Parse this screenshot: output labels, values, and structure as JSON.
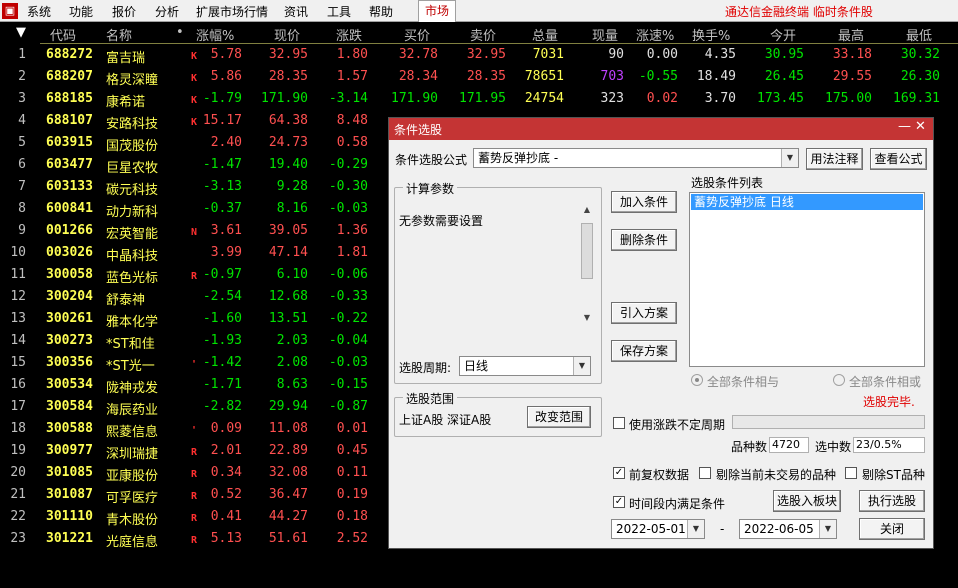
{
  "menubar": {
    "items": [
      "系统",
      "功能",
      "报价",
      "分析",
      "扩展市场行情",
      "资讯",
      "工具",
      "帮助"
    ],
    "active_tab": "市场",
    "app_title": "通达信金融终端 临时条件股"
  },
  "table": {
    "headers": [
      "代码",
      "名称",
      "•",
      "涨幅%",
      "现价",
      "涨跌",
      "买价",
      "卖价",
      "总量",
      "现量",
      "涨速%",
      "换手%",
      "今开",
      "最高",
      "最低"
    ],
    "rows": [
      {
        "idx": "1",
        "code": "688272",
        "name": "富吉瑞",
        "flag": "K",
        "pct": "5.78",
        "price": "32.95",
        "chg": "1.80",
        "bid": "32.78",
        "ask": "32.95",
        "vol": "7031",
        "now": "90",
        "spd": "0.00",
        "turn": "4.35",
        "open": "30.95",
        "high": "33.18",
        "low": "30.32"
      },
      {
        "idx": "2",
        "code": "688207",
        "name": "格灵深瞳",
        "flag": "K",
        "pct": "5.86",
        "price": "28.35",
        "chg": "1.57",
        "bid": "28.34",
        "ask": "28.35",
        "vol": "78651",
        "now": "703",
        "spd": "-0.55",
        "turn": "18.49",
        "open": "26.45",
        "high": "29.55",
        "low": "26.30"
      },
      {
        "idx": "3",
        "code": "688185",
        "name": "康希诺",
        "flag": "K",
        "pct": "-1.79",
        "price": "171.90",
        "chg": "-3.14",
        "bid": "171.90",
        "ask": "171.95",
        "vol": "24754",
        "now": "323",
        "spd": "0.02",
        "turn": "3.70",
        "open": "173.45",
        "high": "175.00",
        "low": "169.31"
      },
      {
        "idx": "4",
        "code": "688107",
        "name": "安路科技",
        "flag": "K",
        "pct": "15.17",
        "price": "64.38",
        "chg": "8.48"
      },
      {
        "idx": "5",
        "code": "603915",
        "name": "国茂股份",
        "flag": "",
        "pct": "2.40",
        "price": "24.73",
        "chg": "0.58"
      },
      {
        "idx": "6",
        "code": "603477",
        "name": "巨星农牧",
        "flag": "",
        "pct": "-1.47",
        "price": "19.40",
        "chg": "-0.29"
      },
      {
        "idx": "7",
        "code": "603133",
        "name": "碳元科技",
        "flag": "",
        "pct": "-3.13",
        "price": "9.28",
        "chg": "-0.30"
      },
      {
        "idx": "8",
        "code": "600841",
        "name": "动力新科",
        "flag": "",
        "pct": "-0.37",
        "price": "8.16",
        "chg": "-0.03"
      },
      {
        "idx": "9",
        "code": "001266",
        "name": "宏英智能",
        "flag": "N",
        "pct": "3.61",
        "price": "39.05",
        "chg": "1.36"
      },
      {
        "idx": "10",
        "code": "003026",
        "name": "中晶科技",
        "flag": "",
        "pct": "3.99",
        "price": "47.14",
        "chg": "1.81"
      },
      {
        "idx": "11",
        "code": "300058",
        "name": "蓝色光标",
        "flag": "R",
        "pct": "-0.97",
        "price": "6.10",
        "chg": "-0.06"
      },
      {
        "idx": "12",
        "code": "300204",
        "name": "舒泰神",
        "flag": "",
        "pct": "-2.54",
        "price": "12.68",
        "chg": "-0.33"
      },
      {
        "idx": "13",
        "code": "300261",
        "name": "雅本化学",
        "flag": "",
        "pct": "-1.60",
        "price": "13.51",
        "chg": "-0.22"
      },
      {
        "idx": "14",
        "code": "300273",
        "name": "*ST和佳",
        "flag": "",
        "pct": "-1.93",
        "price": "2.03",
        "chg": "-0.04"
      },
      {
        "idx": "15",
        "code": "300356",
        "name": "*ST光一",
        "flag": "'",
        "pct": "-1.42",
        "price": "2.08",
        "chg": "-0.03"
      },
      {
        "idx": "16",
        "code": "300534",
        "name": "陇神戎发",
        "flag": "",
        "pct": "-1.71",
        "price": "8.63",
        "chg": "-0.15"
      },
      {
        "idx": "17",
        "code": "300584",
        "name": "海辰药业",
        "flag": "",
        "pct": "-2.82",
        "price": "29.94",
        "chg": "-0.87"
      },
      {
        "idx": "18",
        "code": "300588",
        "name": "熙菱信息",
        "flag": "'",
        "pct": "0.09",
        "price": "11.08",
        "chg": "0.01"
      },
      {
        "idx": "19",
        "code": "300977",
        "name": "深圳瑞捷",
        "flag": "R",
        "pct": "2.01",
        "price": "22.89",
        "chg": "0.45"
      },
      {
        "idx": "20",
        "code": "301085",
        "name": "亚康股份",
        "flag": "R",
        "pct": "0.34",
        "price": "32.08",
        "chg": "0.11"
      },
      {
        "idx": "21",
        "code": "301087",
        "name": "可孚医疗",
        "flag": "R",
        "pct": "0.52",
        "price": "36.47",
        "chg": "0.19"
      },
      {
        "idx": "22",
        "code": "301110",
        "name": "青木股份",
        "flag": "R",
        "pct": "0.41",
        "price": "44.27",
        "chg": "0.18"
      },
      {
        "idx": "23",
        "code": "301221",
        "name": "光庭信息",
        "flag": "R",
        "pct": "5.13",
        "price": "51.61",
        "chg": "2.52"
      }
    ]
  },
  "dialog": {
    "title": "条件选股",
    "formula_label": "条件选股公式",
    "formula_value": "蓄势反弹抄底 -",
    "usage_button": "用法注释",
    "view_formula_button": "查看公式",
    "calc_params_legend": "计算参数",
    "no_params_text": "无参数需要设置",
    "period_label": "选股周期:",
    "period_value": "日线",
    "range_legend": "选股范围",
    "range_value": "上证A股 深证A股",
    "change_range_button": "改变范围",
    "add_condition_button": "加入条件",
    "delete_condition_button": "删除条件",
    "import_plan_button": "引入方案",
    "save_plan_button": "保存方案",
    "condition_list_label": "选股条件列表",
    "condition_items": [
      "蓄势反弹抄底  日线"
    ],
    "radio_and": "全部条件相与",
    "radio_or": "全部条件相或",
    "status_text": "选股完毕.",
    "use_range_label": "使用涨跌不定周期",
    "stock_count_label": "品种数",
    "stock_count_value": "4720",
    "selected_label": "选中数",
    "selected_value": "23/0.5%",
    "fq_label": "前复权数据",
    "exclude_untraded_label": "剔除当前未交易的品种",
    "exclude_st_label": "剔除ST品种",
    "time_condition_label": "时间段内满足条件",
    "to_board_button": "选股入板块",
    "execute_button": "执行选股",
    "date_from": "2022-05-01",
    "date_sep": "-",
    "date_to": "2022-06-05",
    "close_button": "关闭"
  }
}
